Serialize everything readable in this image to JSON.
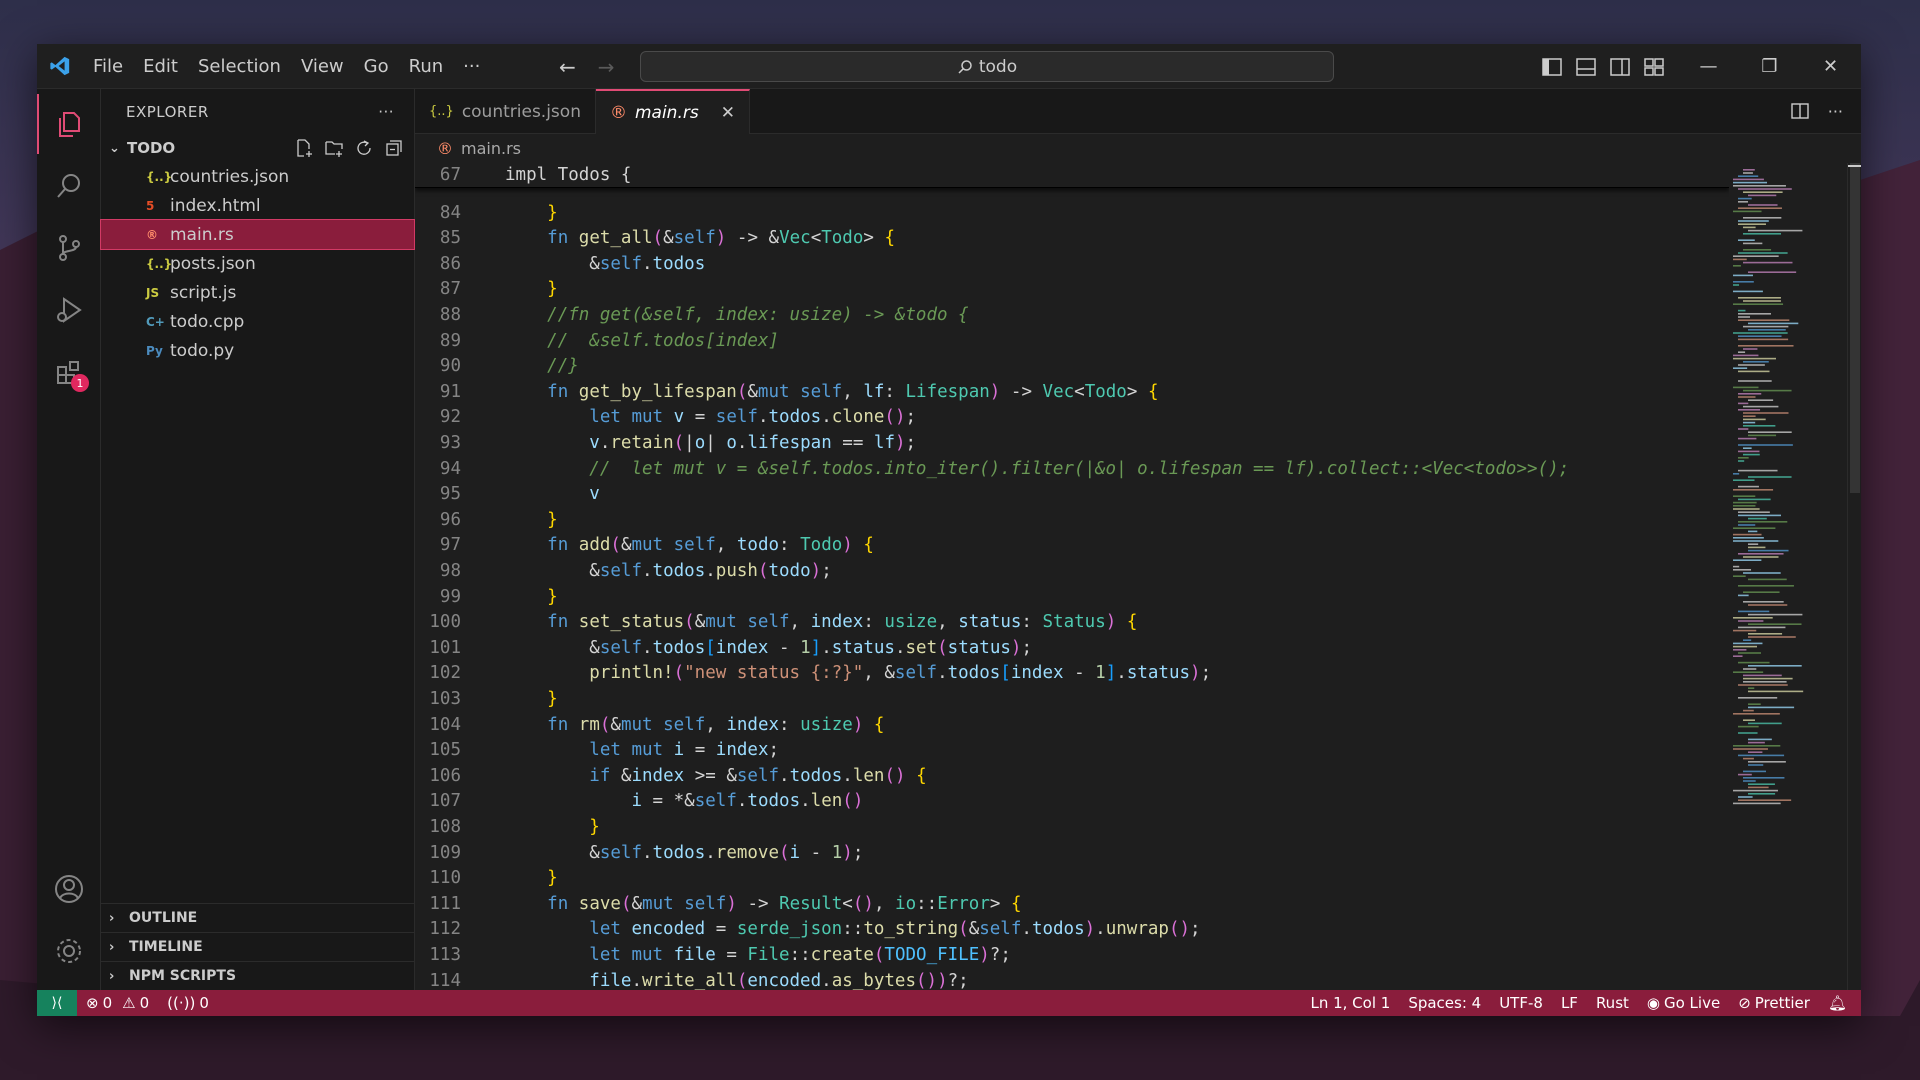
{
  "menu": [
    "File",
    "Edit",
    "Selection",
    "View",
    "Go",
    "Run",
    "···"
  ],
  "search": {
    "text": "todo"
  },
  "sidebar": {
    "title": "EXPLORER",
    "more": "···",
    "folder": "TODO",
    "files": [
      {
        "name": "countries.json",
        "icon": "json-icon",
        "glyph": "{..}",
        "color": "#cbcb41"
      },
      {
        "name": "index.html",
        "icon": "html-icon",
        "glyph": "5",
        "color": "#e44d26"
      },
      {
        "name": "main.rs",
        "icon": "rust-icon",
        "glyph": "®",
        "color": "#e04b3a"
      },
      {
        "name": "posts.json",
        "icon": "json-icon",
        "glyph": "{..}",
        "color": "#cbcb41"
      },
      {
        "name": "script.js",
        "icon": "js-icon",
        "glyph": "JS",
        "color": "#cbcb41"
      },
      {
        "name": "todo.cpp",
        "icon": "cpp-icon",
        "glyph": "C+",
        "color": "#519aba"
      },
      {
        "name": "todo.py",
        "icon": "python-icon",
        "glyph": "Py",
        "color": "#3572a5"
      }
    ],
    "sections": [
      "OUTLINE",
      "TIMELINE",
      "NPM SCRIPTS"
    ]
  },
  "activity": {
    "extensions_badge": "1"
  },
  "tabs": [
    {
      "label": "countries.json",
      "glyph": "{..}",
      "active": false
    },
    {
      "label": "main.rs",
      "glyph": "®",
      "active": true,
      "close": "✕"
    }
  ],
  "breadcrumb": {
    "file": "main.rs"
  },
  "code": {
    "sticky": {
      "num": "67",
      "text": "impl Todos {"
    },
    "lines": [
      {
        "num": "84",
        "text": "    }"
      },
      {
        "num": "85",
        "text": "    fn get_all(&self) -> &Vec<Todo> {"
      },
      {
        "num": "86",
        "text": "        &self.todos"
      },
      {
        "num": "87",
        "text": "    }"
      },
      {
        "num": "88",
        "text": "    //fn get(&self, index: usize) -> &todo {"
      },
      {
        "num": "89",
        "text": "    //  &self.todos[index]"
      },
      {
        "num": "90",
        "text": "    //}"
      },
      {
        "num": "91",
        "text": "    fn get_by_lifespan(&mut self, lf: Lifespan) -> Vec<Todo> {"
      },
      {
        "num": "92",
        "text": "        let mut v = self.todos.clone();"
      },
      {
        "num": "93",
        "text": "        v.retain(|o| o.lifespan == lf);"
      },
      {
        "num": "94",
        "text": "        //  let mut v = &self.todos.into_iter().filter(|&o| o.lifespan == lf).collect::<Vec<todo>>();"
      },
      {
        "num": "95",
        "text": "        v"
      },
      {
        "num": "96",
        "text": "    }"
      },
      {
        "num": "97",
        "text": "    fn add(&mut self, todo: Todo) {"
      },
      {
        "num": "98",
        "text": "        &self.todos.push(todo);"
      },
      {
        "num": "99",
        "text": "    }"
      },
      {
        "num": "100",
        "text": "    fn set_status(&mut self, index: usize, status: Status) {"
      },
      {
        "num": "101",
        "text": "        &self.todos[index - 1].status.set(status);"
      },
      {
        "num": "102",
        "text": "        println!(\"new status {:?}\", &self.todos[index - 1].status);"
      },
      {
        "num": "103",
        "text": "    }"
      },
      {
        "num": "104",
        "text": "    fn rm(&mut self, index: usize) {"
      },
      {
        "num": "105",
        "text": "        let mut i = index;"
      },
      {
        "num": "106",
        "text": "        if &index >= &self.todos.len() {"
      },
      {
        "num": "107",
        "text": "            i = *&self.todos.len()"
      },
      {
        "num": "108",
        "text": "        }"
      },
      {
        "num": "109",
        "text": "        &self.todos.remove(i - 1);"
      },
      {
        "num": "110",
        "text": "    }"
      },
      {
        "num": "111",
        "text": "    fn save(&mut self) -> Result<(), io::Error> {"
      },
      {
        "num": "112",
        "text": "        let encoded = serde_json::to_string(&self.todos).unwrap();"
      },
      {
        "num": "113",
        "text": "        let mut file = File::create(TODO_FILE)?;"
      },
      {
        "num": "114",
        "text": "        file.write_all(encoded.as_bytes())?;"
      }
    ]
  },
  "status": {
    "errors": "0",
    "warnings": "0",
    "ports": "0",
    "position": "Ln 1, Col 1",
    "spaces": "Spaces: 4",
    "encoding": "UTF-8",
    "eol": "LF",
    "language": "Rust",
    "golive": "Go Live",
    "prettier": "Prettier"
  },
  "colors": {
    "accent": "#8a1d3c",
    "remote": "#16825d",
    "tab_border": "#e04b75"
  }
}
